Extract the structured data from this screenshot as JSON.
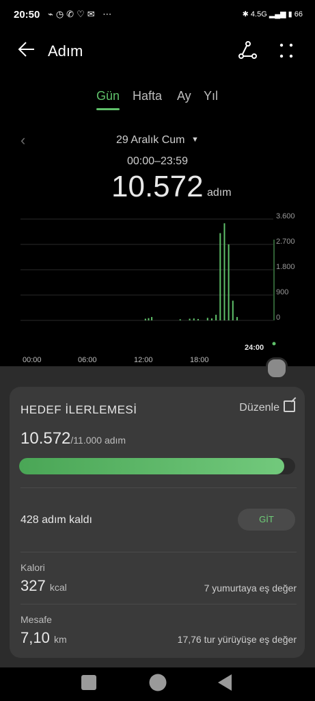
{
  "status_bar": {
    "time": "20:50",
    "battery": "66",
    "network": "4.5G"
  },
  "app_bar": {
    "title": "Adım"
  },
  "tabs": [
    {
      "label": "Gün",
      "active": true
    },
    {
      "label": "Hafta",
      "active": false
    },
    {
      "label": "Ay",
      "active": false
    },
    {
      "label": "Yıl",
      "active": false
    }
  ],
  "date": {
    "label": "29 Aralık Cum",
    "range": "00:00–23:59"
  },
  "summary": {
    "steps": "10.572",
    "unit": "adım"
  },
  "chart_data": {
    "type": "bar",
    "x_labels": [
      "00:00",
      "06:00",
      "12:00",
      "18:00",
      "24:00"
    ],
    "y_ticks": [
      "3.600",
      "2.700",
      "1.800",
      "900",
      "0"
    ],
    "ylim": [
      0,
      3600
    ],
    "hour_bins": [
      {
        "hour": 11.6,
        "value": 60
      },
      {
        "hour": 11.9,
        "value": 80
      },
      {
        "hour": 12.2,
        "value": 120
      },
      {
        "hour": 14.9,
        "value": 40
      },
      {
        "hour": 15.8,
        "value": 60
      },
      {
        "hour": 16.2,
        "value": 70
      },
      {
        "hour": 16.6,
        "value": 50
      },
      {
        "hour": 17.5,
        "value": 90
      },
      {
        "hour": 17.9,
        "value": 70
      },
      {
        "hour": 18.3,
        "value": 200
      },
      {
        "hour": 18.7,
        "value": 3100
      },
      {
        "hour": 19.1,
        "value": 3450
      },
      {
        "hour": 19.5,
        "value": 2700
      },
      {
        "hour": 19.9,
        "value": 700
      },
      {
        "hour": 20.3,
        "value": 120
      }
    ]
  },
  "goal": {
    "title": "HEDEF İLERLEMESİ",
    "edit_label": "Düzenle",
    "current": "10.572",
    "target_text": "/11.000 adım",
    "progress_fraction": 0.961,
    "remaining_text": "428 adım kaldı",
    "go_label": "GİT"
  },
  "metrics": {
    "calorie": {
      "label": "Kalori",
      "value": "327",
      "unit": "kcal",
      "equivalent": "7 yumurtaya eş değer"
    },
    "distance": {
      "label": "Mesafe",
      "value": "7,10",
      "unit": "km",
      "equivalent": "17,76 tur yürüyüşe eş değer"
    }
  },
  "colors": {
    "accent": "#5fc16a",
    "card": "#3a3a3a",
    "sheet": "#2c2c2c"
  }
}
